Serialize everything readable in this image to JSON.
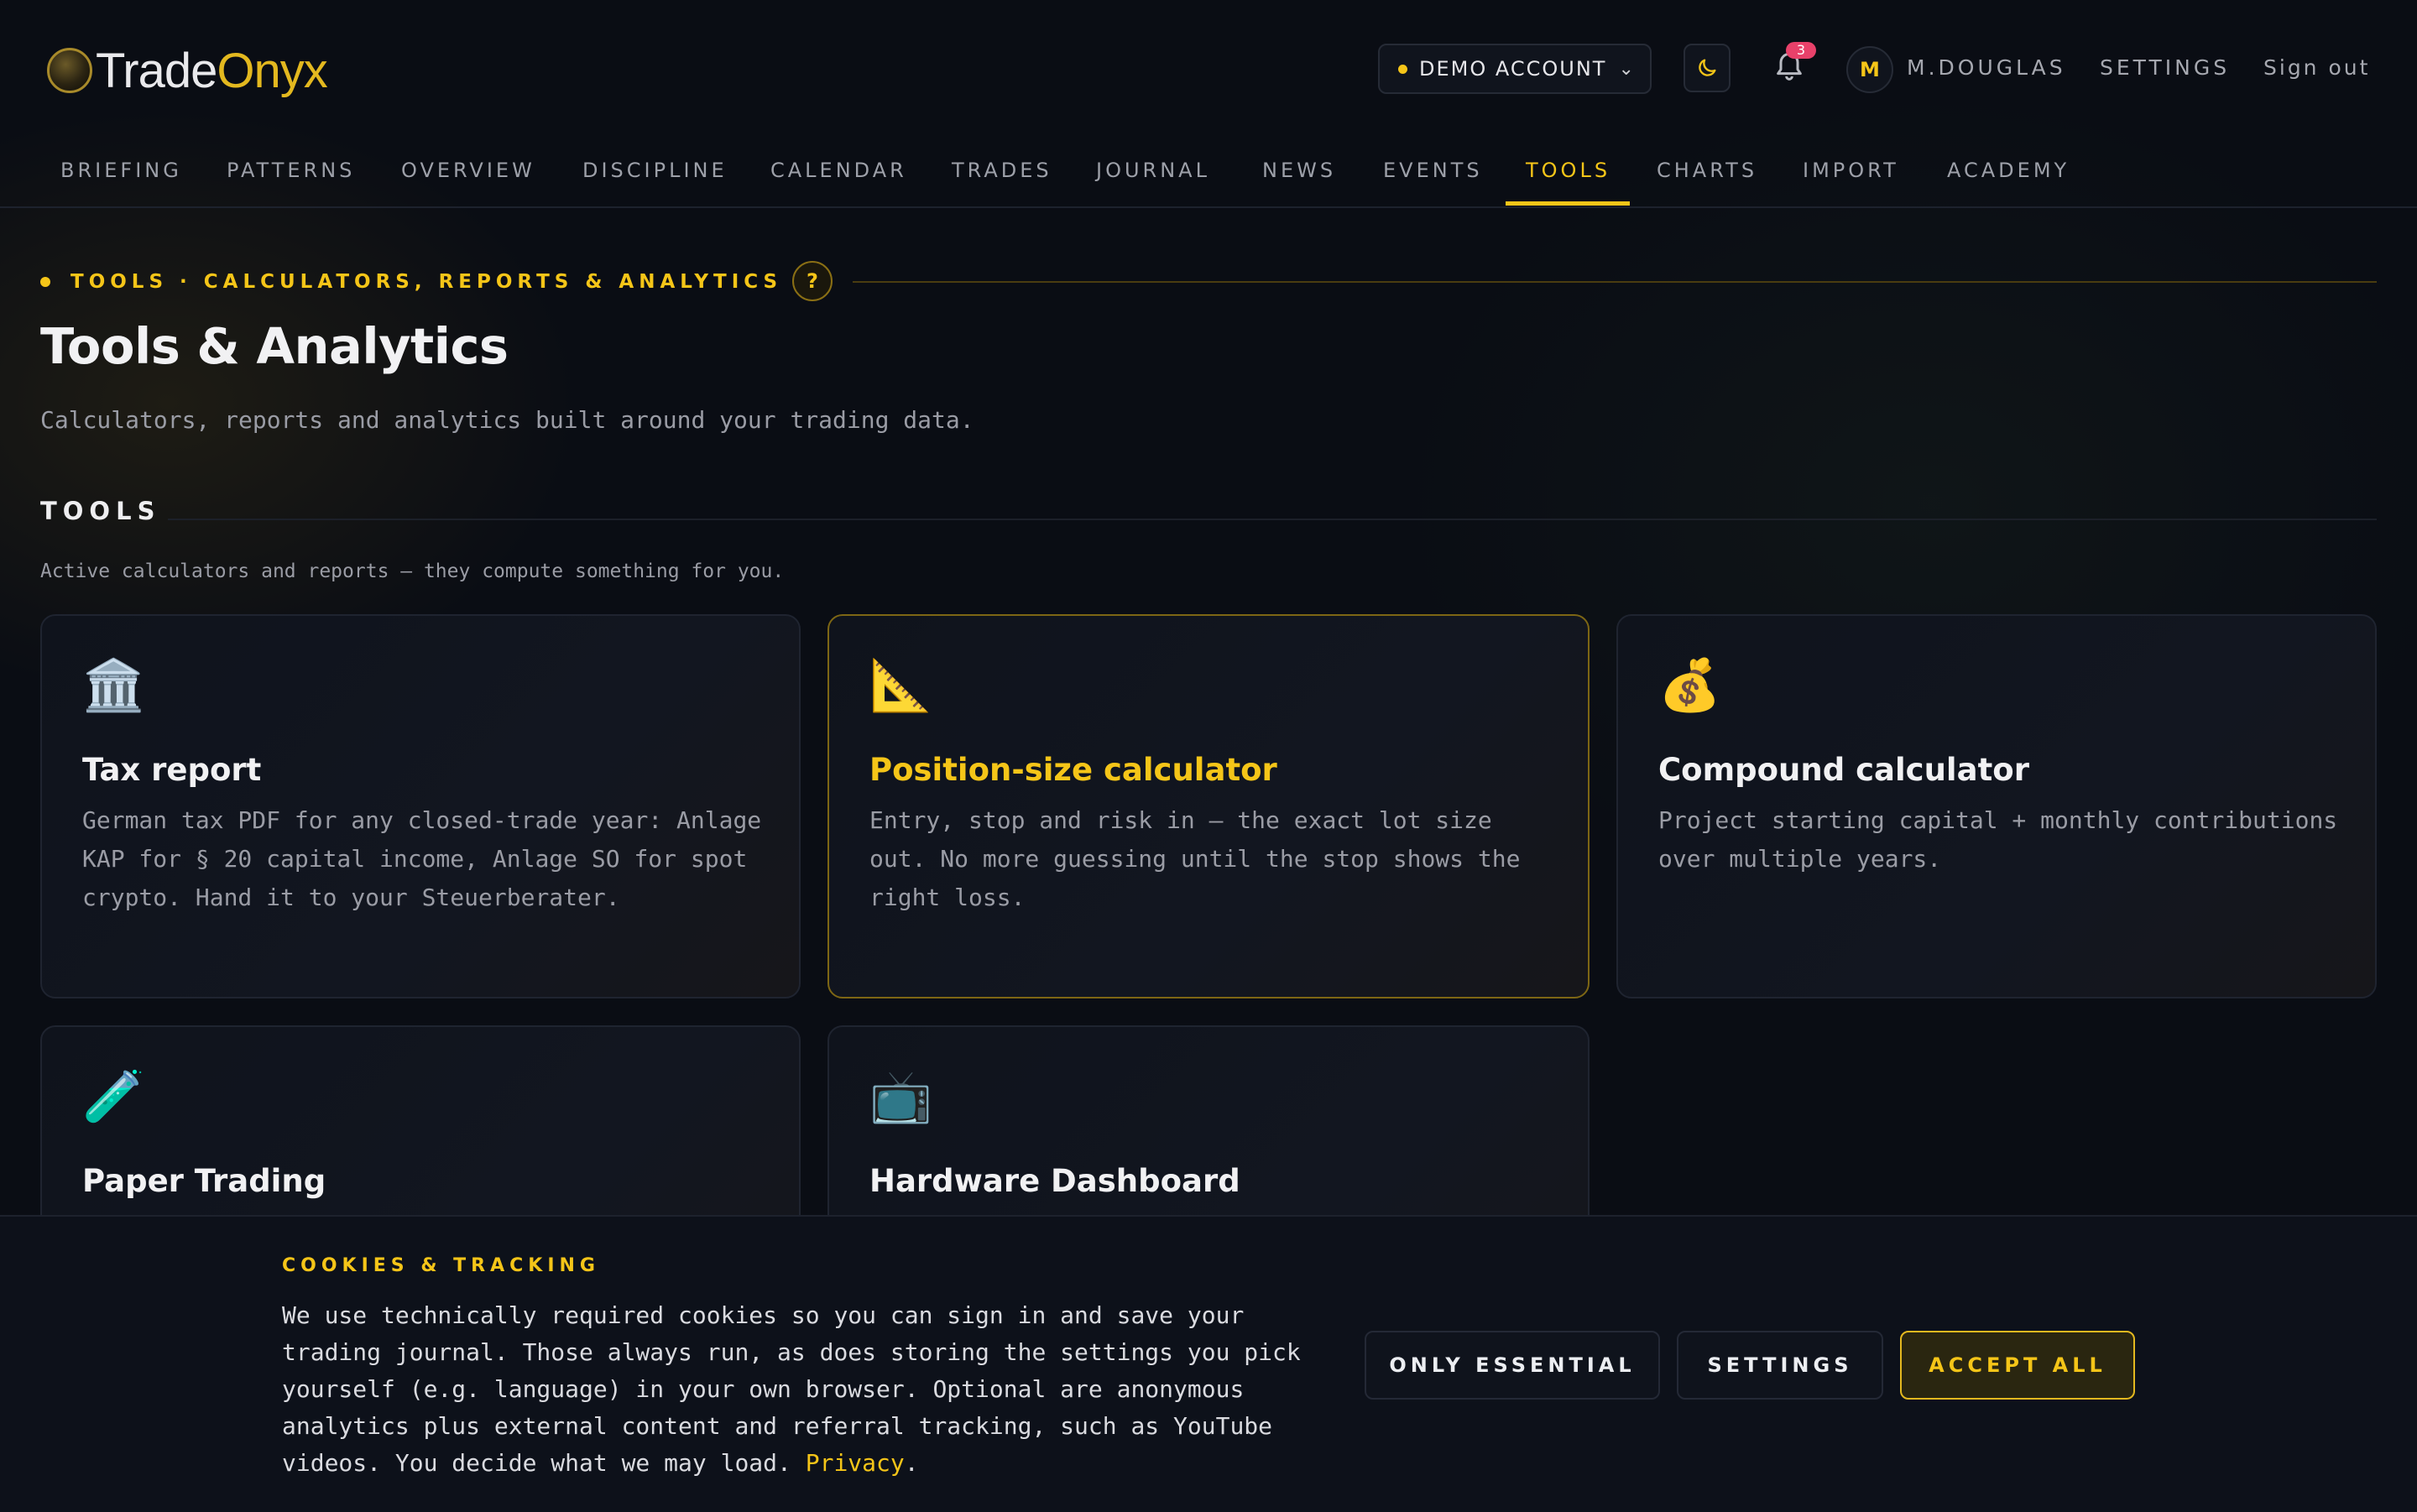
{
  "brand": {
    "name_part1": "Trade",
    "name_part2": "Onyx",
    "accent": "#f5c518"
  },
  "header": {
    "account_label": "DEMO ACCOUNT",
    "notifications_count": "3",
    "avatar_initial": "M",
    "username": "M.DOUGLAS",
    "settings_label": "SETTINGS",
    "signout_label": "Sign out"
  },
  "nav": {
    "active": "TOOLS",
    "items": [
      "BRIEFING",
      "PATTERNS",
      "OVERVIEW",
      "DISCIPLINE",
      "CALENDAR",
      "TRADES",
      "JOURNAL",
      "NEWS",
      "EVENTS",
      "TOOLS",
      "CHARTS",
      "IMPORT",
      "ACADEMY"
    ]
  },
  "page": {
    "eyebrow": "TOOLS · CALCULATORS, REPORTS & ANALYTICS",
    "help_glyph": "?",
    "title": "Tools & Analytics",
    "subtitle": "Calculators, reports and analytics built around your trading data."
  },
  "section": {
    "title": "TOOLS",
    "subtitle": "Active calculators and reports — they compute something for you."
  },
  "cards": [
    {
      "icon": "🏛️",
      "icon_name": "bank-icon",
      "title": "Tax report",
      "desc": "German tax PDF for any closed-trade year: Anlage KAP for § 20 capital income, Anlage SO for spot crypto. Hand it to your Steuerberater."
    },
    {
      "icon": "📐",
      "icon_name": "ruler-triangle-icon",
      "title": "Position-size calculator",
      "desc": "Entry, stop and risk in — the exact lot size out. No more guessing until the stop shows the right loss."
    },
    {
      "icon": "💰",
      "icon_name": "money-bag-icon",
      "title": "Compound calculator",
      "desc": "Project starting capital + monthly contributions over multiple years."
    },
    {
      "icon": "🧪",
      "icon_name": "test-tube-icon",
      "title": "Paper Trading",
      "desc": ""
    },
    {
      "icon": "📺",
      "icon_name": "television-icon",
      "title": "Hardware Dashboard",
      "desc": ""
    }
  ],
  "cookie": {
    "title": "COOKIES & TRACKING",
    "text": "We use technically required cookies so you can sign in and save your trading journal. Those always run, as does storing the settings you pick yourself (e.g. language) in your own browser. Optional are anonymous analytics plus external content and referral tracking, such as YouTube videos. You decide what we may load.",
    "link": "Privacy",
    "after_link": ".",
    "btn_essential": "ONLY ESSENTIAL",
    "btn_settings": "SETTINGS",
    "btn_accept": "ACCEPT ALL"
  }
}
